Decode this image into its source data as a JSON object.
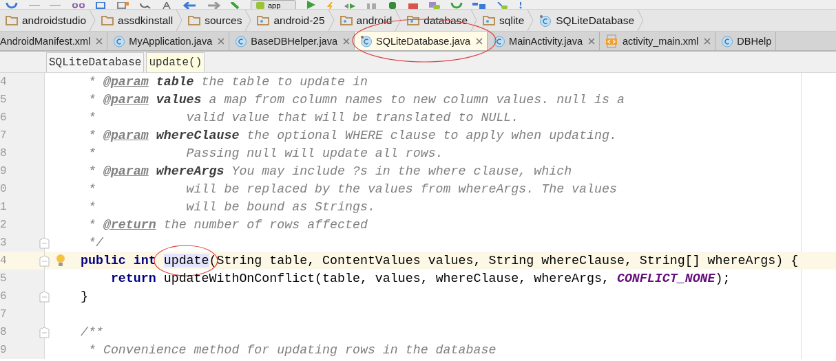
{
  "toolbar": {
    "run_config": "app"
  },
  "breadcrumbs": [
    {
      "label": "androidstudio",
      "kind": "folder"
    },
    {
      "label": "assdkinstall",
      "kind": "folder"
    },
    {
      "label": "sources",
      "kind": "folder"
    },
    {
      "label": "android-25",
      "kind": "package"
    },
    {
      "label": "android",
      "kind": "package"
    },
    {
      "label": "database",
      "kind": "package"
    },
    {
      "label": "sqlite",
      "kind": "package"
    },
    {
      "label": "SQLiteDatabase",
      "kind": "class"
    }
  ],
  "tabs": [
    {
      "label": "AndroidManifest.xml",
      "kind": "plain",
      "selected": false,
      "circled": false
    },
    {
      "label": "MyApplication.java",
      "kind": "class",
      "selected": false,
      "circled": false
    },
    {
      "label": "BaseDBHelper.java",
      "kind": "class",
      "selected": false,
      "circled": false
    },
    {
      "label": "SQLiteDatabase.java",
      "kind": "class",
      "selected": true,
      "circled": true
    },
    {
      "label": "MainActivity.java",
      "kind": "class",
      "selected": false,
      "circled": false
    },
    {
      "label": "activity_main.xml",
      "kind": "layout",
      "selected": false,
      "circled": false
    },
    {
      "label": "DBHelp",
      "kind": "class",
      "selected": false,
      "circled": false
    }
  ],
  "structure_path": [
    {
      "label": "SQLiteDatabase",
      "selected": false
    },
    {
      "label": "update()",
      "selected": true
    }
  ],
  "code": {
    "lines": [
      {
        "number": "4",
        "fold": false,
        "current": false,
        "intention": false,
        "tokens": [
          {
            "kind": "comment",
            "text": " * "
          },
          {
            "kind": "doc_tag",
            "text": "@param"
          },
          {
            "kind": "doc_param",
            "text": " table"
          },
          {
            "kind": "comment",
            "text": " the table to update in"
          }
        ]
      },
      {
        "number": "5",
        "fold": false,
        "current": false,
        "intention": false,
        "tokens": [
          {
            "kind": "comment",
            "text": " * "
          },
          {
            "kind": "doc_tag",
            "text": "@param"
          },
          {
            "kind": "doc_param",
            "text": " values"
          },
          {
            "kind": "comment",
            "text": " a map from column names to new column values. null is a"
          }
        ]
      },
      {
        "number": "6",
        "fold": false,
        "current": false,
        "intention": false,
        "tokens": [
          {
            "kind": "comment",
            "text": " *            valid value that will be translated to NULL."
          }
        ]
      },
      {
        "number": "7",
        "fold": false,
        "current": false,
        "intention": false,
        "tokens": [
          {
            "kind": "comment",
            "text": " * "
          },
          {
            "kind": "doc_tag",
            "text": "@param"
          },
          {
            "kind": "doc_param",
            "text": " whereClause"
          },
          {
            "kind": "comment",
            "text": " the optional WHERE clause to apply when updating."
          }
        ]
      },
      {
        "number": "8",
        "fold": false,
        "current": false,
        "intention": false,
        "tokens": [
          {
            "kind": "comment",
            "text": " *            Passing null will update all rows."
          }
        ]
      },
      {
        "number": "9",
        "fold": false,
        "current": false,
        "intention": false,
        "tokens": [
          {
            "kind": "comment",
            "text": " * "
          },
          {
            "kind": "doc_tag",
            "text": "@param"
          },
          {
            "kind": "doc_param",
            "text": " whereArgs"
          },
          {
            "kind": "comment",
            "text": " You may include ?s in the where clause, which"
          }
        ]
      },
      {
        "number": "0",
        "fold": false,
        "current": false,
        "intention": false,
        "tokens": [
          {
            "kind": "comment",
            "text": " *            will be replaced by the values from whereArgs. The values"
          }
        ]
      },
      {
        "number": "1",
        "fold": false,
        "current": false,
        "intention": false,
        "tokens": [
          {
            "kind": "comment",
            "text": " *            will be bound as Strings."
          }
        ]
      },
      {
        "number": "2",
        "fold": false,
        "current": false,
        "intention": false,
        "tokens": [
          {
            "kind": "comment",
            "text": " * "
          },
          {
            "kind": "doc_tag",
            "text": "@return"
          },
          {
            "kind": "comment",
            "text": " the number of rows affected"
          }
        ]
      },
      {
        "number": "3",
        "fold": true,
        "current": false,
        "intention": false,
        "tokens": [
          {
            "kind": "comment",
            "text": " */"
          }
        ]
      },
      {
        "number": "4",
        "fold": true,
        "current": true,
        "intention": true,
        "tokens": [
          {
            "kind": "keyword",
            "text": "public "
          },
          {
            "kind": "keyword",
            "text": "int "
          },
          {
            "kind": "usage",
            "text": "update",
            "circled": true
          },
          {
            "kind": "plain",
            "text": "(String table, ContentValues values, String whereClause, String[] whereArgs) {"
          }
        ]
      },
      {
        "number": "5",
        "fold": false,
        "current": false,
        "intention": false,
        "tokens": [
          {
            "kind": "keyword",
            "text": "    return"
          },
          {
            "kind": "plain",
            "text": " updateWithOnConflict(table, values, whereClause, whereArgs, "
          },
          {
            "kind": "constant",
            "text": "CONFLICT_NONE"
          },
          {
            "kind": "plain",
            "text": ");"
          }
        ]
      },
      {
        "number": "6",
        "fold": true,
        "current": false,
        "intention": false,
        "tokens": [
          {
            "kind": "plain",
            "text": "}"
          }
        ]
      },
      {
        "number": "7",
        "fold": false,
        "current": false,
        "intention": false
      },
      {
        "number": "8",
        "fold": true,
        "current": false,
        "intention": false,
        "tokens": [
          {
            "kind": "comment",
            "text": "/**"
          }
        ]
      },
      {
        "number": "9",
        "fold": false,
        "current": false,
        "intention": false,
        "tokens": [
          {
            "kind": "comment",
            "text": " * Convenience method for updating rows in the database"
          }
        ]
      }
    ]
  }
}
